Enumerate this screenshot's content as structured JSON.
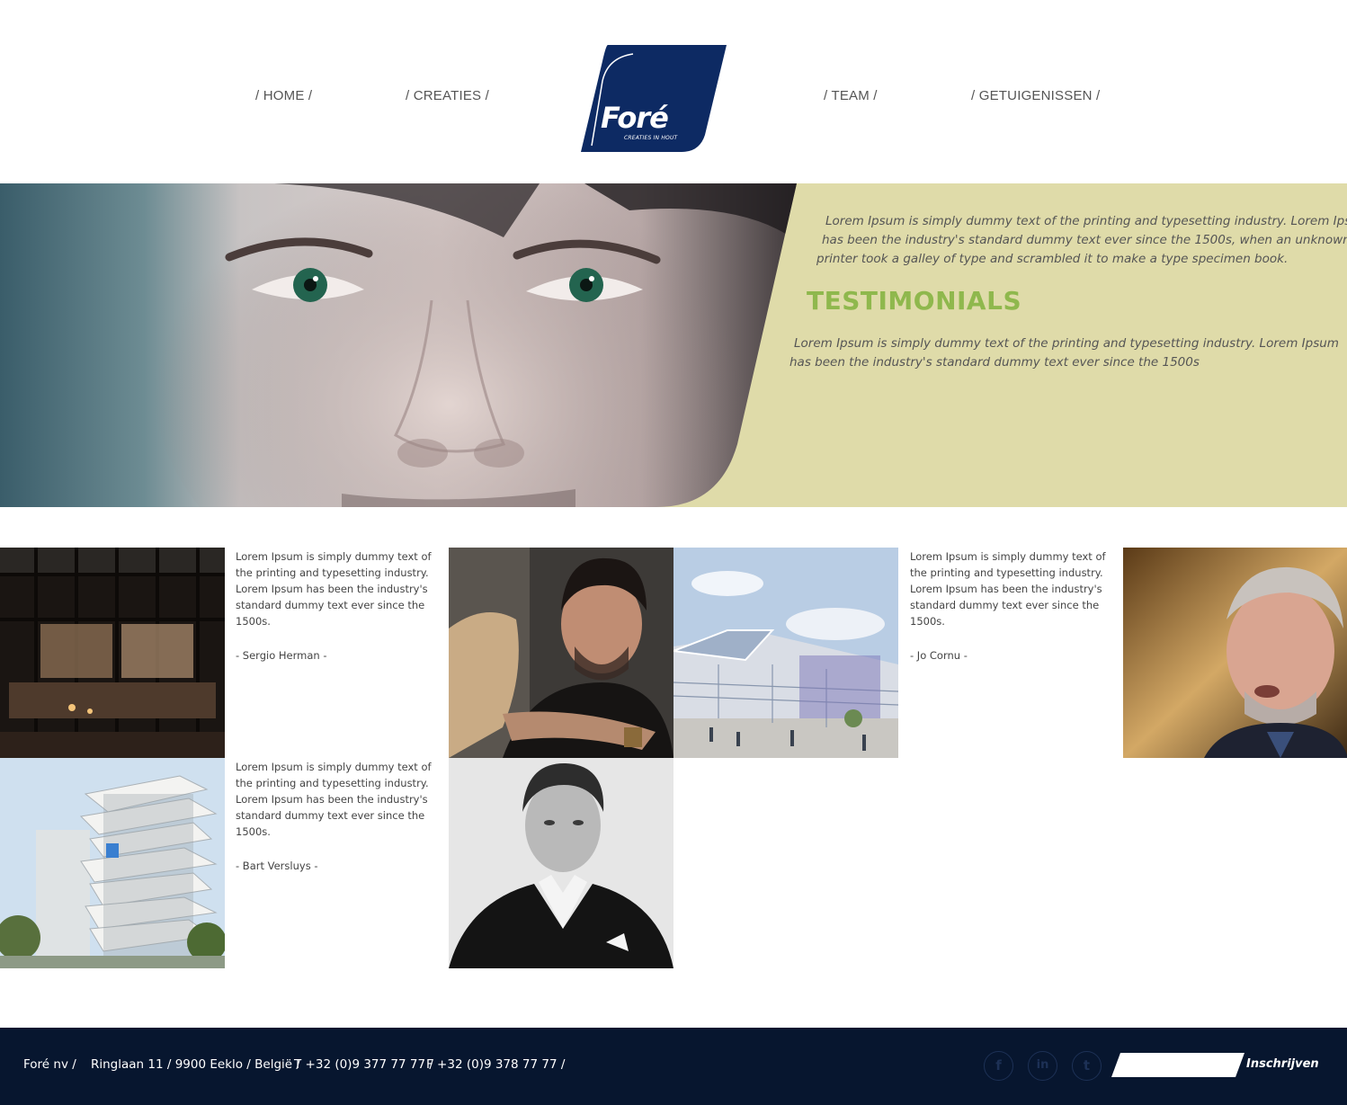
{
  "nav": {
    "home": "/ HOME /",
    "creaties": "/ CREATIES /",
    "team": "/ TEAM /",
    "getuigenissen": "/ GETUIGENISSEN /"
  },
  "logo": {
    "name": "Foré",
    "tagline": "CREATIES IN HOUT",
    "color": "#0d2a63"
  },
  "hero": {
    "intro_lines": [
      "Lorem Ipsum is simply dummy text of the printing and typesetting industry. Lorem Ipsum",
      "has been the industry's standard dummy text ever since the 1500s, when an unknown",
      "printer took a galley of type and scrambled it to make a type specimen book."
    ],
    "title": "TESTIMONIALS",
    "body_lines": [
      "Lorem Ipsum is simply dummy text of the printing and typesetting industry. Lorem Ipsum",
      "has been the industry's standard dummy text ever since the 1500s"
    ],
    "background": "#dfdba9",
    "title_color": "#8fb84d"
  },
  "testimonials": [
    {
      "text": "Lorem Ipsum is simply dummy text of the printing and typesetting industry. Lorem Ipsum has been the industry's standard dummy text ever since the 1500s.",
      "author": "- Sergio Herman -"
    },
    {
      "text": "Lorem Ipsum is simply dummy text of the printing and typesetting industry. Lorem Ipsum has been the industry's standard dummy text ever since the 1500s.",
      "author": "- Jo Cornu -"
    },
    {
      "text": "Lorem Ipsum is simply dummy text of the printing and typesetting industry. Lorem Ipsum has been the industry's standard dummy text ever since the 1500s.",
      "author": "- Bart Versluys -"
    }
  ],
  "footer": {
    "company": "Foré nv /",
    "address": "Ringlaan 11 / 9900 Eeklo / België /",
    "phone": "T +32 (0)9 377 77 77 /",
    "fax": "F +32 (0)9 378 77 77 /",
    "social": {
      "facebook": "f",
      "linkedin": "in",
      "twitter": "t"
    },
    "subscribe_label": "Inschrijven",
    "background": "#07162f"
  }
}
